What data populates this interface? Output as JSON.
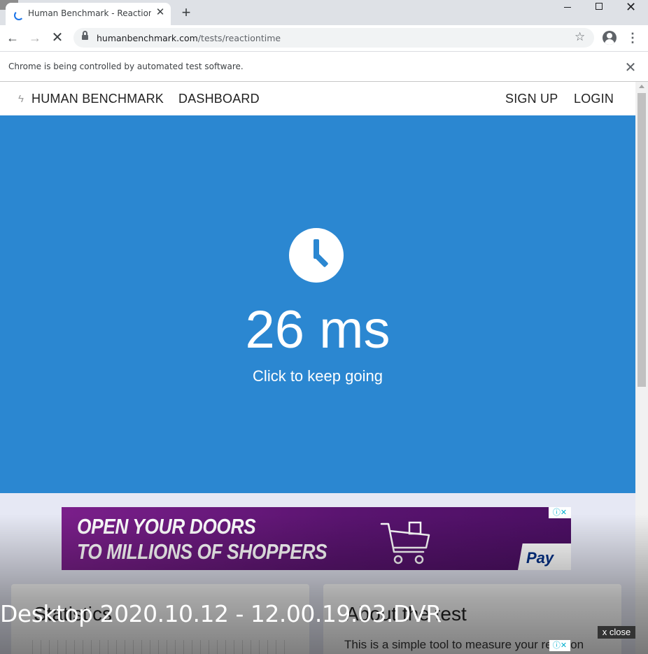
{
  "browser": {
    "tab_title": "Human Benchmark - Reaction Time Test",
    "tab_close": "✕",
    "new_tab": "+",
    "window_close": "✕",
    "back": "←",
    "forward": "→",
    "stop": "✕",
    "url_host": "humanbenchmark.com",
    "url_path": "/tests/reactiontime",
    "bookmark_star": "☆",
    "menu": "⋮",
    "infobar_message": "Chrome is being controlled by automated test software.",
    "infobar_close": "✕"
  },
  "site_nav": {
    "bolt": "ϟ",
    "brand": "HUMAN BENCHMARK",
    "dashboard": "DASHBOARD",
    "signup": "SIGN UP",
    "login": "LOGIN"
  },
  "hero": {
    "result": "26 ms",
    "hint": "Click to keep going",
    "background_color": "#2b87d1"
  },
  "ad": {
    "line1": "OPEN YOUR DOORS",
    "line2": "TO MILLIONS OF SHOPPERS",
    "brand_text": "Pay",
    "adchoice": "ⓘ✕"
  },
  "cards": {
    "left_heading": "Statistics",
    "right_heading": "About the test",
    "right_body": "This is a simple tool to measure your reaction"
  },
  "overlay": {
    "recording_title": "Desktop 2020.10.12 - 12.00.19.03.DVR",
    "close_label": "x close",
    "adchoice": "ⓘ✕"
  }
}
